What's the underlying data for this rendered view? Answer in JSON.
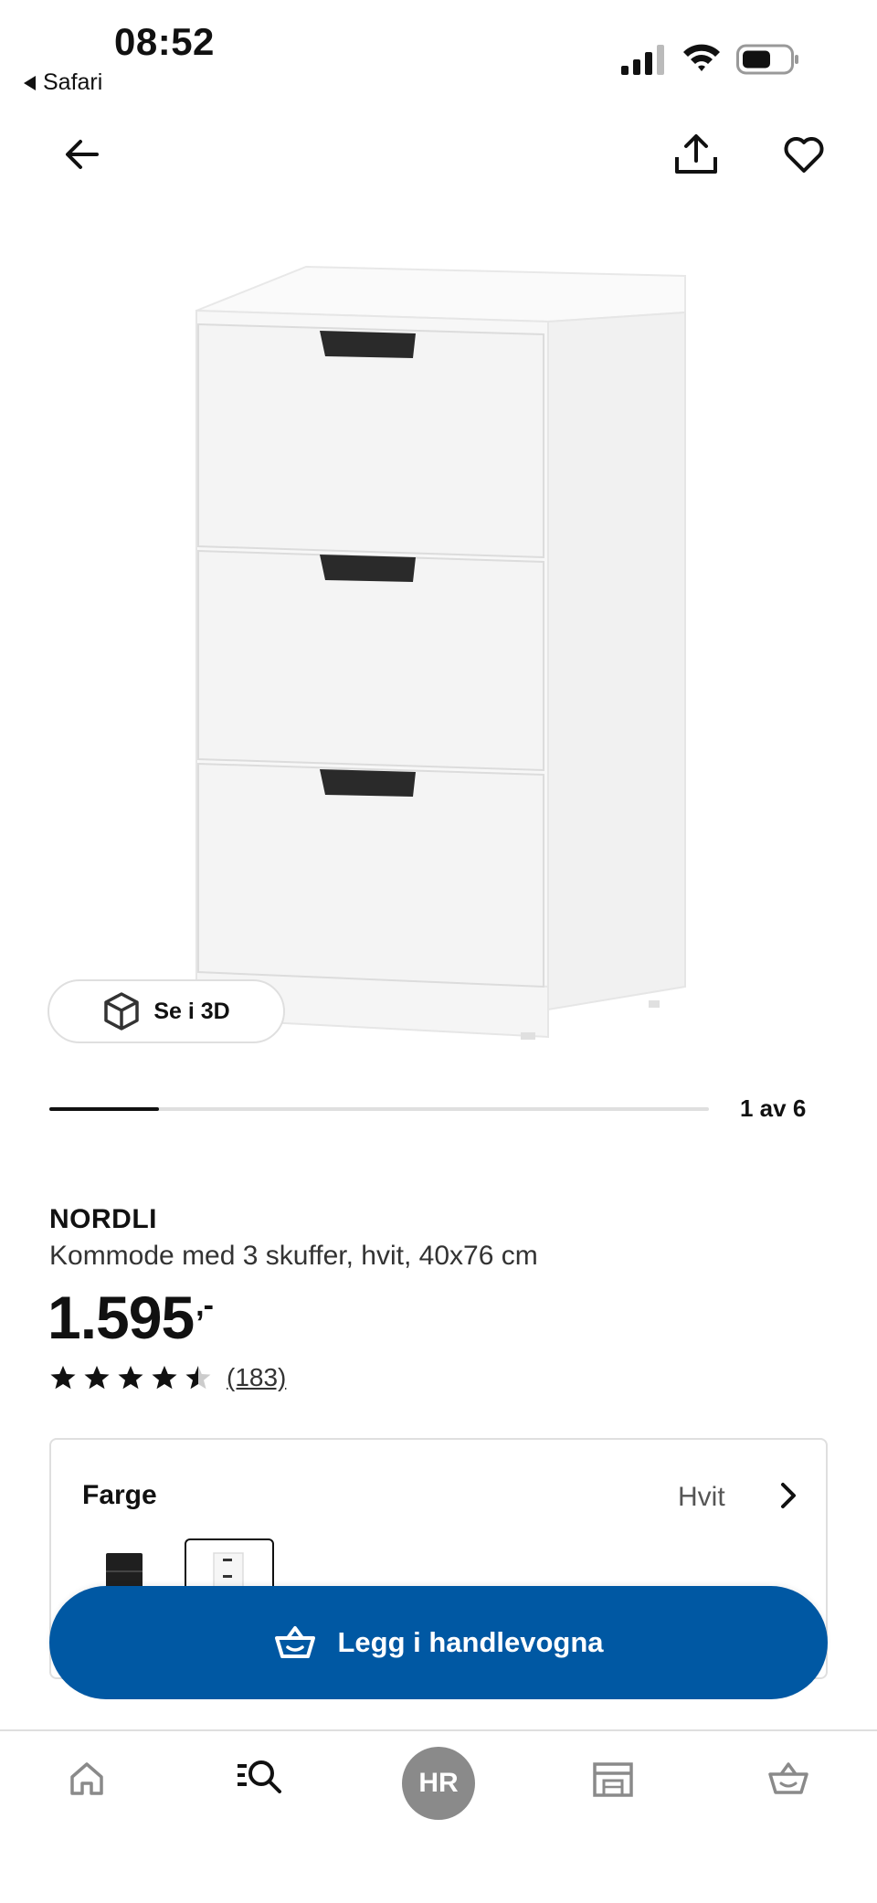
{
  "status_bar": {
    "time": "08:52",
    "back_app": "Safari"
  },
  "icons": {
    "back": "arrow-left-icon",
    "share": "share-icon",
    "favourite": "heart-icon",
    "view_3d": "cube-icon",
    "color_chevron": "chevron-right-icon",
    "cart_button": "basket-icon",
    "tabs": [
      "home-icon",
      "search-icon",
      "avatar",
      "stores-icon",
      "basket-icon"
    ]
  },
  "gallery": {
    "view_3d_label": "Se i 3D",
    "counter": "1 av 6",
    "progress": 0.166
  },
  "product": {
    "brand": "NORDLI",
    "description": "Kommode med 3 skuffer, hvit, 40x76 cm",
    "price": "1.595",
    "price_suffix": ",-",
    "rating": 4.5,
    "rating_count": "(183)"
  },
  "color_selector": {
    "label": "Farge",
    "value": "Hvit"
  },
  "cta": {
    "label": "Legg i handlevogna"
  },
  "tabbar": {
    "avatar_initials": "HR"
  },
  "colors": {
    "primary_blue": "#0058a3",
    "border_gray": "#dfdfdf",
    "text_dark": "#111111",
    "avatar_gray": "#8a8a8a"
  }
}
